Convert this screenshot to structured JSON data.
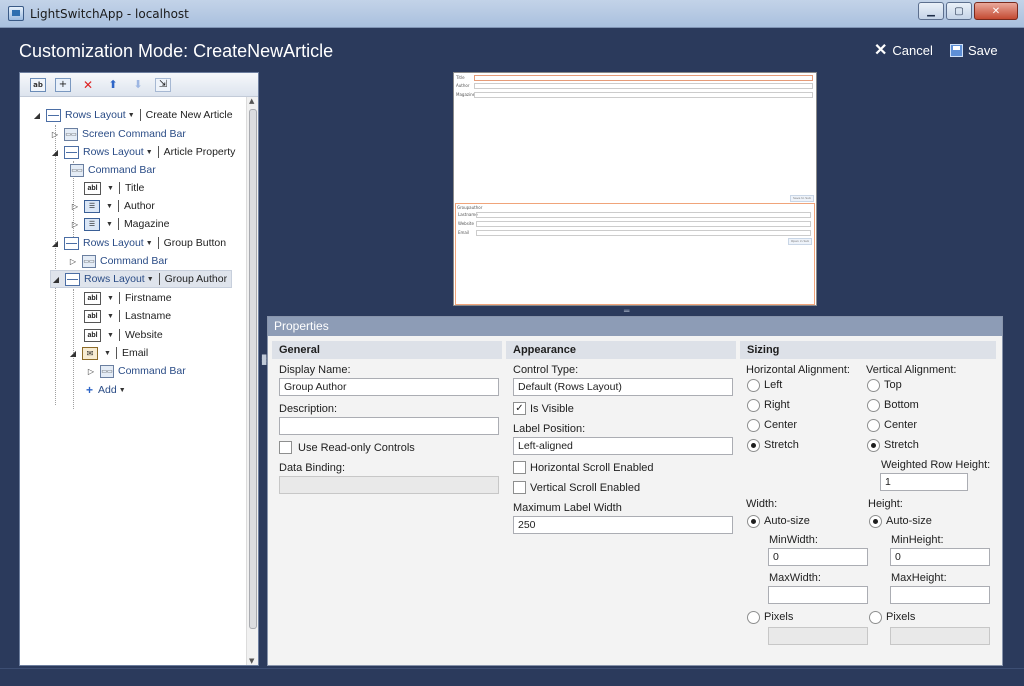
{
  "window": {
    "title": "LightSwitchApp - localhost"
  },
  "header": {
    "title": "Customization Mode: CreateNewArticle",
    "cancel_label": "Cancel",
    "save_label": "Save"
  },
  "tree": {
    "toolbar_icons": [
      "add-field-icon",
      "add-group-icon",
      "delete-icon",
      "move-up-icon",
      "move-down-icon",
      "move-to-icon"
    ],
    "nodes": {
      "root": {
        "mode": "Rows Layout",
        "label": "Create New Article"
      },
      "screen_cmd": {
        "label": "Screen Command Bar"
      },
      "article_prop": {
        "mode": "Rows Layout",
        "label": "Article Property"
      },
      "cmd1": {
        "label": "Command Bar"
      },
      "title": {
        "label": "Title"
      },
      "author": {
        "label": "Author"
      },
      "magazine": {
        "label": "Magazine"
      },
      "group_button": {
        "mode": "Rows Layout",
        "label": "Group Button"
      },
      "cmd2": {
        "label": "Command Bar"
      },
      "group_author": {
        "mode": "Rows Layout",
        "label": "Group Author"
      },
      "firstname": {
        "label": "Firstname"
      },
      "lastname": {
        "label": "Lastname"
      },
      "website": {
        "label": "Website"
      },
      "email": {
        "label": "Email"
      },
      "cmd3": {
        "label": "Command Bar"
      },
      "add": {
        "label": "Add"
      }
    },
    "icon_text": {
      "text": "abl"
    }
  },
  "preview": {
    "fields": [
      "Title",
      "Author",
      "Magazine"
    ],
    "group_title": "Groupauthor",
    "group_fields": [
      "Lastname",
      "Website",
      "Email"
    ],
    "btn1": "Save to Sub",
    "btn2": "Open in Sub"
  },
  "properties": {
    "title": "Properties",
    "general": {
      "header": "General",
      "display_name_label": "Display Name:",
      "display_name_value": "Group Author",
      "description_label": "Description:",
      "description_value": "",
      "readonly_label": "Use Read-only Controls",
      "readonly_checked": false,
      "data_binding_label": "Data Binding:",
      "data_binding_value": ""
    },
    "appearance": {
      "header": "Appearance",
      "control_type_label": "Control Type:",
      "control_type_value": "Default (Rows Layout)",
      "is_visible_label": "Is Visible",
      "is_visible_checked": true,
      "label_position_label": "Label Position:",
      "label_position_value": "Left-aligned",
      "h_scroll_label": "Horizontal Scroll Enabled",
      "v_scroll_label": "Vertical Scroll Enabled",
      "max_label_width_label": "Maximum Label Width",
      "max_label_width_value": "250"
    },
    "sizing": {
      "header": "Sizing",
      "h_align_label": "Horizontal Alignment:",
      "h_align_options": [
        "Left",
        "Right",
        "Center",
        "Stretch"
      ],
      "h_align_selected": "Stretch",
      "v_align_label": "Vertical Alignment:",
      "v_align_options": [
        "Top",
        "Bottom",
        "Center",
        "Stretch"
      ],
      "v_align_selected": "Stretch",
      "weighted_row_height_label": "Weighted Row Height:",
      "weighted_row_height_value": "1",
      "width_label": "Width:",
      "height_label": "Height:",
      "auto_size_label": "Auto-size",
      "min_width_label": "MinWidth:",
      "min_width_value": "0",
      "min_height_label": "MinHeight:",
      "min_height_value": "0",
      "max_width_label": "MaxWidth:",
      "max_width_value": "",
      "max_height_label": "MaxHeight:",
      "max_height_value": "",
      "pixels_label": "Pixels"
    }
  },
  "colors": {
    "background": "#2b3a5c",
    "props_header": "#8d9cb6",
    "preview_highlight": "#f0a47a"
  }
}
